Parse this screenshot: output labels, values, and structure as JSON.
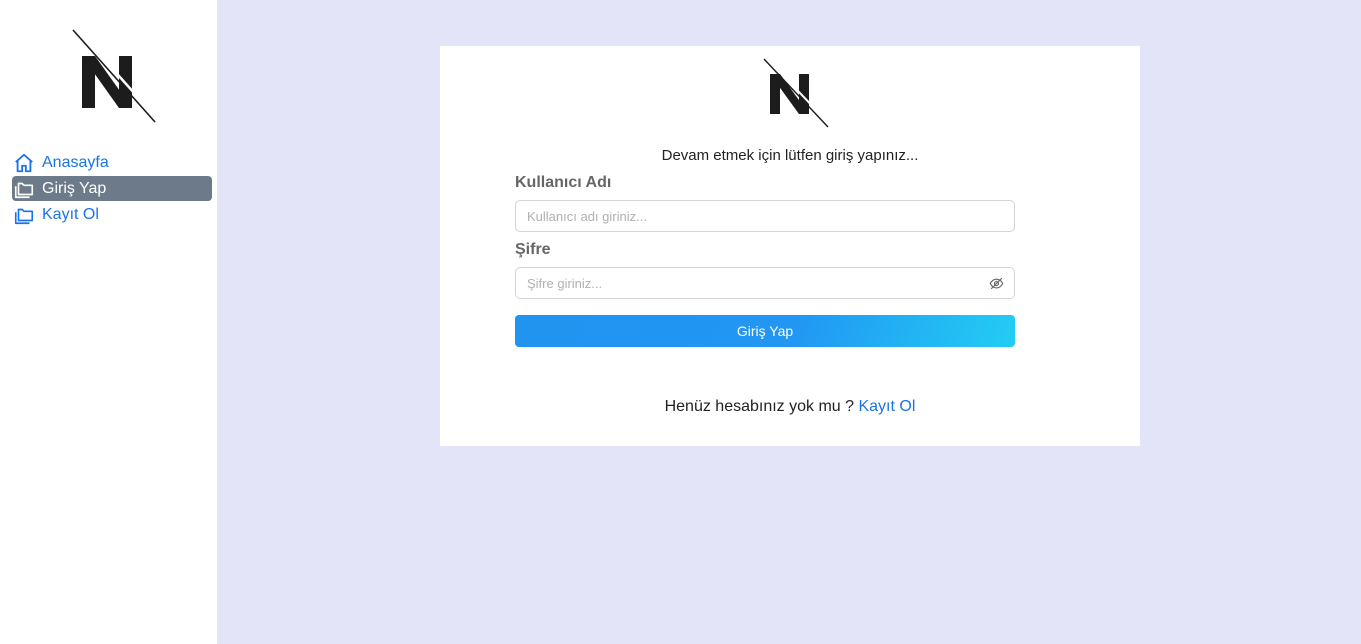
{
  "sidebar": {
    "logo": "N",
    "items": [
      {
        "label": "Anasayfa",
        "icon": "home-icon",
        "active": false
      },
      {
        "label": "Giriş Yap",
        "icon": "folders-icon",
        "active": true
      },
      {
        "label": "Kayıt Ol",
        "icon": "folders-icon",
        "active": false
      }
    ]
  },
  "card": {
    "logo": "N",
    "prompt": "Devam etmek için lütfen giriş yapınız...",
    "username": {
      "label": "Kullanıcı Adı",
      "placeholder": "Kullanıcı adı giriniz...",
      "value": ""
    },
    "password": {
      "label": "Şifre",
      "placeholder": "Şifre giriniz...",
      "value": "",
      "toggle_icon": "eye-slash-icon"
    },
    "submit_label": "Giriş Yap",
    "signup_prompt": "Henüz hesabınız yok mu ?",
    "signup_link": "Kayıt Ol"
  },
  "colors": {
    "background": "#e3e4f8",
    "link": "#1a73e8",
    "active_nav": "#6c7a89",
    "button_gradient_start": "#2196f3",
    "button_gradient_end": "#23cdf3"
  }
}
